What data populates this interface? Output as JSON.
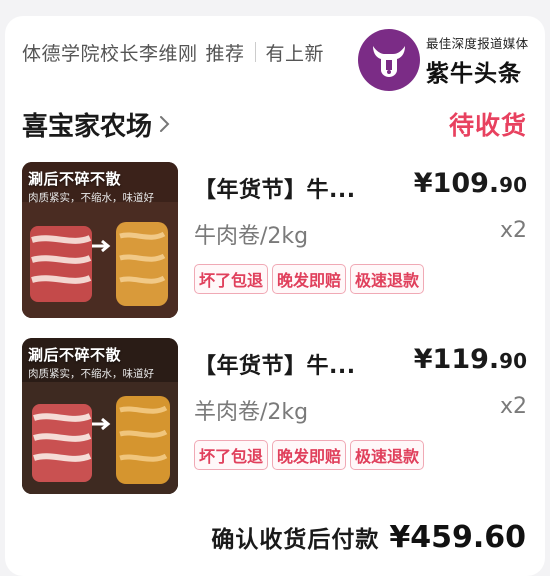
{
  "banner": {
    "text": "体德学院校长李维刚",
    "tag": "推荐",
    "tail": "有上新"
  },
  "watermark": {
    "tagline": "最佳深度报道媒体",
    "name": "紫牛头条",
    "logo_color": "#7b2c86"
  },
  "shop": {
    "name": "喜宝家农场",
    "status": "待收货",
    "status_color": "#e8415f"
  },
  "items": [
    {
      "thumb_title": "涮后不碎不散",
      "thumb_sub": "肉质紧实，不缩水，味道好",
      "title": "【年货节】牛...",
      "price_main": "¥109.",
      "price_cents": "90",
      "spec": "牛肉卷/2kg",
      "qty": "x2",
      "badges": [
        "坏了包退",
        "晚发即赔",
        "极速退款"
      ]
    },
    {
      "thumb_title": "涮后不碎不散",
      "thumb_sub": "肉质紧实，不缩水，味道好",
      "title": "【年货节】牛...",
      "price_main": "¥119.",
      "price_cents": "90",
      "spec": "羊肉卷/2kg",
      "qty": "x2",
      "badges": [
        "坏了包退",
        "晚发即赔",
        "极速退款"
      ]
    }
  ],
  "footer": {
    "label": "确认收货后付款",
    "amount": "¥459.60"
  }
}
